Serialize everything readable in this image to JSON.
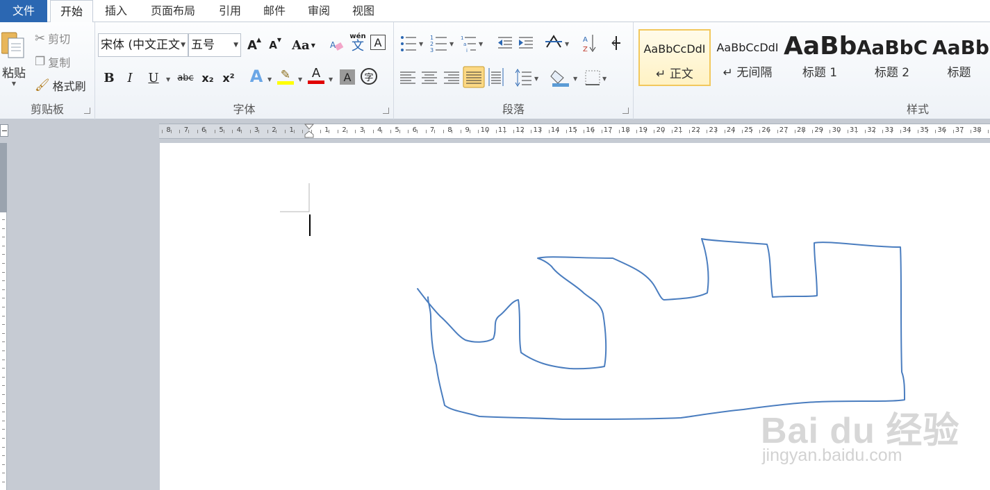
{
  "tabs": [
    {
      "label": "文件"
    },
    {
      "label": "开始"
    },
    {
      "label": "插入"
    },
    {
      "label": "页面布局"
    },
    {
      "label": "引用"
    },
    {
      "label": "邮件"
    },
    {
      "label": "审阅"
    },
    {
      "label": "视图"
    }
  ],
  "clipboard": {
    "paste_label": "粘贴",
    "cut_label": "剪切",
    "copy_label": "复制",
    "format_painter_label": "格式刷",
    "group_label": "剪贴板"
  },
  "font": {
    "font_name": "宋体 (中文正文",
    "font_size": "五号",
    "group_label": "字体",
    "bold": "B",
    "italic": "I",
    "underline": "U",
    "strike": "abc",
    "sub": "x₂",
    "sup": "x²",
    "case": "Aa",
    "grow": "A",
    "shrink": "A",
    "pinyin_top": "wén",
    "pinyin_char": "文",
    "border_char": "A",
    "shade_char": "A",
    "enclose_char": "字",
    "font_color_char": "A",
    "highlight_color": "#ffff00",
    "font_color": "#e00000"
  },
  "paragraph": {
    "group_label": "段落"
  },
  "styles": {
    "group_label": "样式",
    "items": [
      {
        "preview": "AaBbCcDdI",
        "name": "↵ 正文"
      },
      {
        "preview": "AaBbCcDdI",
        "name": "↵ 无间隔"
      },
      {
        "preview": "AaBb",
        "name": "标题 1"
      },
      {
        "preview": "AaBbC",
        "name": "标题 2"
      },
      {
        "preview": "AaBbC",
        "name": "标题"
      }
    ]
  },
  "ruler": {
    "left_numbers": [
      "8",
      "7",
      "6",
      "5",
      "4",
      "3",
      "2",
      "1"
    ],
    "right_numbers": [
      "1",
      "2",
      "3",
      "4",
      "5",
      "6",
      "7",
      "8",
      "9",
      "10",
      "11",
      "12",
      "13",
      "14",
      "15",
      "16",
      "17",
      "18",
      "19",
      "20",
      "21",
      "22",
      "23",
      "24",
      "25",
      "26",
      "27",
      "28",
      "29",
      "30",
      "31",
      "32",
      "33",
      "34",
      "35",
      "36",
      "37",
      "38"
    ]
  },
  "document": {
    "paragraph_mark": "↵"
  },
  "watermark": {
    "brand": "Bai du 经验",
    "url": "jingyan.baidu.com"
  },
  "colors": {
    "file_tab": "#2b67b2",
    "drawing_stroke": "#4a7dbf",
    "selected_style_border": "#f2c85c"
  }
}
